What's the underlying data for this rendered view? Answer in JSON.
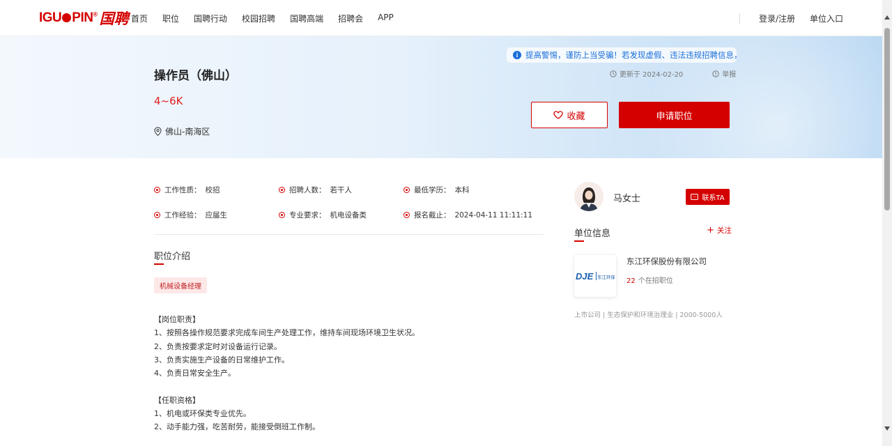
{
  "header": {
    "logo_text_a": "IGU",
    "logo_text_b": "PIN",
    "logo_mark": "®",
    "logo_cn": "国聘",
    "nav": [
      "首页",
      "职位",
      "国聘行动",
      "校园招聘",
      "国聘高端",
      "招聘会",
      "APP"
    ],
    "login_label": "登录/注册",
    "employer_label": "单位入口"
  },
  "job": {
    "title": "操作员（佛山）",
    "salary": "4~6K",
    "location": "佛山-南海区",
    "notice": "提高警惕，谨防上当受骗！若发现虚假、违法违规招聘信息，",
    "updated": "更新于 2024-02-20",
    "report": "举报",
    "favorite_label": "收藏",
    "apply_label": "申请职位"
  },
  "attributes": [
    {
      "key": "工作性质：",
      "value": "校招"
    },
    {
      "key": "招聘人数：",
      "value": "若干人"
    },
    {
      "key": "最低学历：",
      "value": "本科"
    },
    {
      "key": "工作经验：",
      "value": "应届生"
    },
    {
      "key": "专业要求：",
      "value": "机电设备类"
    },
    {
      "key": "报名截止：",
      "value": "2024-04-11 11:11:11"
    }
  ],
  "intro": {
    "title": "职位介绍",
    "tag": "机械设备经理",
    "lines": [
      "【岗位职责】",
      "1、按照各操作规范要求完成车间生产处理工作，维持车间现场环境卫生状况。",
      "2、负责按要求定时对设备运行记录。",
      "3、负责实施生产设备的日常维护工作。",
      "4、负责日常安全生产。",
      "",
      "【任职资格】",
      "1、机电或环保类专业优先。",
      "2、动手能力强，吃苦耐劳，能接受倒班工作制。"
    ]
  },
  "contact": {
    "name": "马女士",
    "button_label": "联系TA"
  },
  "company": {
    "section_title": "单位信息",
    "follow_label": "关注",
    "name": "东江环保股份有限公司",
    "jobs_count": "22",
    "jobs_suffix": "个在招职位",
    "meta": "上市公司 | 生态保护和环境治理业 | 2000-5000人",
    "logo_text": "东江环保"
  },
  "colors": {
    "brand": "#d40000",
    "notice": "#1a6fd9"
  }
}
